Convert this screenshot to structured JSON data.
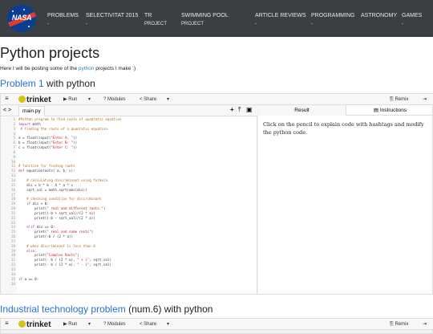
{
  "nav": {
    "logo_text": "NASA",
    "items": [
      {
        "label": "PROBLEMS",
        "caret": "-"
      },
      {
        "label": "SELECTIVITAT 2015",
        "caret": "-"
      },
      {
        "label": "TR",
        "line2": "PROJECT"
      },
      {
        "label": "SWIMMING POOL",
        "line2": "PROJECT"
      },
      {
        "label": "ARTICLE REVIEWS",
        "caret": "-"
      },
      {
        "label": "PROGRAMMING",
        "caret": "-"
      },
      {
        "label": "ASTRONOMY",
        "caret": ""
      },
      {
        "label": "GAMES",
        "caret": "-"
      }
    ]
  },
  "page": {
    "title": "Python projects",
    "intro_before": "Here I will be posting some of the ",
    "intro_link": "python",
    "intro_after": " projects I make :)"
  },
  "section1": {
    "prefix": "Problem 1",
    "suffix": " with python"
  },
  "section2": {
    "prefix": "Industrial technology problem",
    "suffix": " (num.6) with python"
  },
  "toolbar": {
    "menu": "≡",
    "logo": "trinket",
    "run": "▶ Run",
    "run_caret": "▾",
    "modules": "? Modules",
    "share": "< Share",
    "share_caret": "▾",
    "remix": "Remix",
    "exit": "⇥"
  },
  "editor": {
    "nav_arrows": "< >",
    "filename": "main.py",
    "add_file": "+",
    "upload": "⤒",
    "image": "▣",
    "line_numbers": [
      "1",
      "2",
      "3",
      "4",
      "5",
      "6",
      "7",
      "8",
      "9",
      "10",
      "11",
      "12",
      "13",
      "14",
      "15",
      "16",
      "17",
      "18",
      "19",
      "20",
      "21",
      "22",
      "23",
      "24",
      "25",
      "26",
      "27",
      "28",
      "29",
      "30",
      "31",
      "32",
      "33",
      "34",
      "35",
      "36"
    ]
  },
  "result": {
    "tab_result": "Result",
    "tab_instructions": "Instructions",
    "instructions": "Click on the pencil to explain code with hashtags and modify the python code."
  }
}
